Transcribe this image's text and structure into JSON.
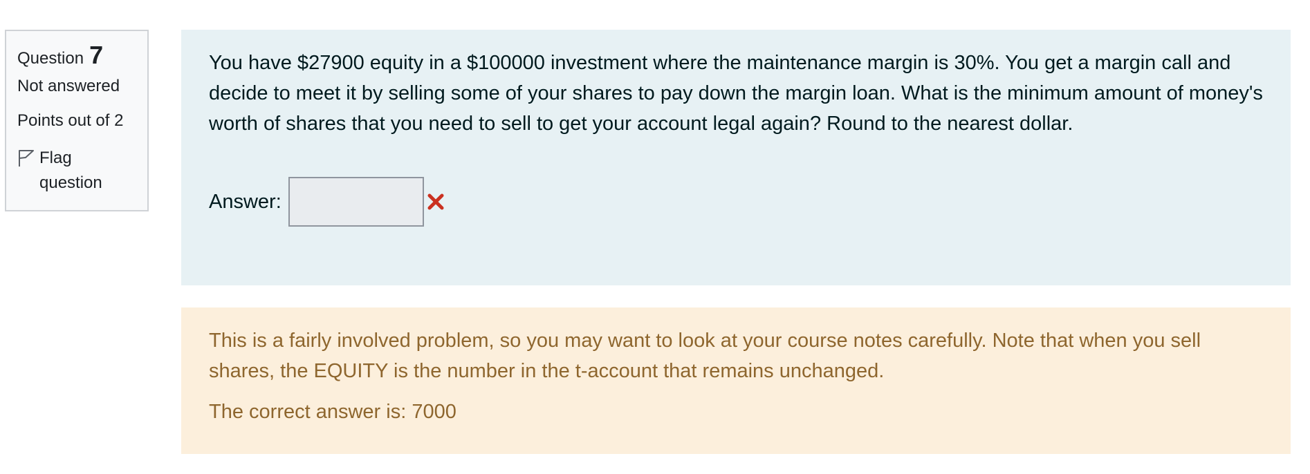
{
  "info": {
    "question_label": "Question",
    "question_number": "7",
    "state": "Not answered",
    "grade": "Points out of 2",
    "flag_label": "Flag question",
    "flag_icon": "flag-icon"
  },
  "question": {
    "text": "You have $27900 equity in a $100000 investment where the maintenance margin is 30%.  You get a margin call and decide to meet it by selling some of your shares to pay down the margin loan.  What is the minimum amount of money's worth of shares that you need to sell to get your account legal again?  Round to the nearest dollar.",
    "answer_label": "Answer:",
    "answer_value": "",
    "incorrect_icon": "incorrect-x-icon"
  },
  "feedback": {
    "general": "This is a fairly involved problem, so you may want to look at your course notes carefully.  Note that when you sell shares, the EQUITY is the number in the t-account that remains unchanged.",
    "right_answer": "The correct answer is: 7000"
  },
  "colors": {
    "info_bg": "#f8f9fa",
    "question_bg": "#e7f1f4",
    "feedback_bg": "#fcefdc",
    "feedback_text": "#8e662e",
    "incorrect": "#ca3120"
  }
}
